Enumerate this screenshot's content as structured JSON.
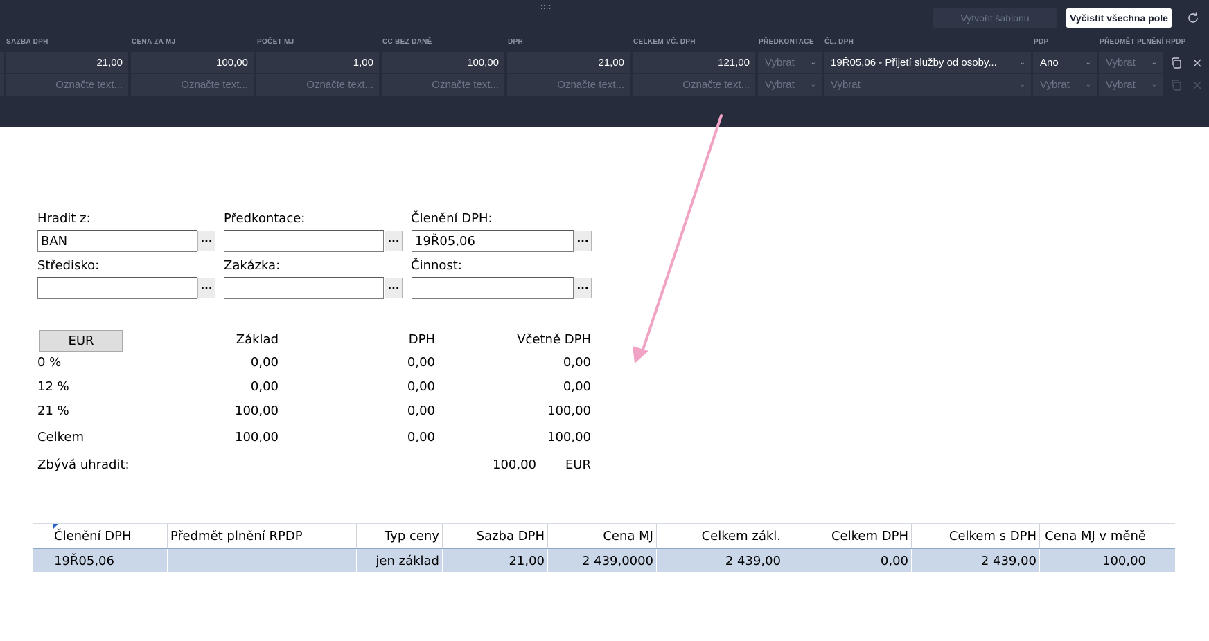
{
  "toolbar": {
    "drag_handle": "::::",
    "template_button": "Vytvořit šablonu",
    "clear_button": "Vyčistit všechna pole"
  },
  "table_headers": [
    "SAZBA DPH",
    "CENA ZA MJ",
    "POČET MJ",
    "CC BEZ DANĚ",
    "DPH",
    "CELKEM VČ. DPH",
    "PŘEDKONTACE",
    "ČL. DPH",
    "PDP",
    "PŘEDMĚT PLNĚNÍ RPDP"
  ],
  "rows": [
    {
      "sazba": "21,00",
      "cena": "100,00",
      "pocet": "1,00",
      "cc": "100,00",
      "dph": "21,00",
      "celkem": "121,00",
      "predkontace": "Vybrat",
      "cl_dph": "19Ř05,06 - Přijetí služby od osoby...",
      "pdp": "Ano",
      "rpdp": "Vybrat"
    },
    {
      "sazba": "Označte text...",
      "cena": "Označte text...",
      "pocet": "Označte text...",
      "cc": "Označte text...",
      "dph": "Označte text...",
      "celkem": "Označte text...",
      "predkontace": "Vybrat",
      "cl_dph": "Vybrat",
      "pdp": "Vybrat",
      "rpdp": "Vybrat"
    }
  ],
  "form": {
    "hradit_label": "Hradit z:",
    "hradit_value": "BAN",
    "predkontace_label": "Předkontace:",
    "predkontace_value": "",
    "cleneni_label": "Členění DPH:",
    "cleneni_value": "19Ř05,06",
    "stredisko_label": "Středisko:",
    "stredisko_value": "",
    "zakazka_label": "Zakázka:",
    "zakazka_value": "",
    "cinnost_label": "Činnost:",
    "cinnost_value": "",
    "dots": "···"
  },
  "summary": {
    "currency_button": "EUR",
    "headers": {
      "zaklad": "Základ",
      "dph": "DPH",
      "vcetne": "Včetně DPH"
    },
    "rows": [
      {
        "rate": "0 %",
        "zaklad": "0,00",
        "dph": "0,00",
        "vcetne": "0,00"
      },
      {
        "rate": "12 %",
        "zaklad": "0,00",
        "dph": "0,00",
        "vcetne": "0,00"
      },
      {
        "rate": "21 %",
        "zaklad": "100,00",
        "dph": "0,00",
        "vcetne": "100,00"
      }
    ],
    "total": {
      "label": "Celkem",
      "zaklad": "100,00",
      "dph": "0,00",
      "vcetne": "100,00"
    },
    "remaining_label": "Zbývá uhradit:",
    "remaining_value": "100,00",
    "remaining_currency": "EUR"
  },
  "grid": {
    "headers": [
      "Členění DPH",
      "Předmět plnění RPDP",
      "Typ ceny",
      "Sazba DPH",
      "Cena MJ",
      "Celkem zákl.",
      "Celkem DPH",
      "Celkem s DPH",
      "Cena MJ v měně"
    ],
    "row": [
      "19Ř05,06",
      "",
      "jen základ",
      "21,00",
      "2 439,0000",
      "2 439,00",
      "0,00",
      "2 439,00",
      "100,00"
    ]
  },
  "colors": {
    "panel": "#262c3b",
    "cell": "#303646",
    "arrow": "#f0a3c4",
    "grid_row": "#c9d7e8"
  }
}
